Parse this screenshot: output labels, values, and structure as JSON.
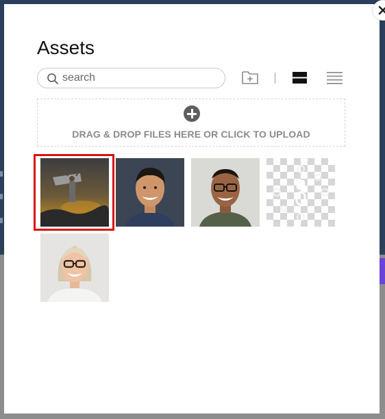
{
  "modal": {
    "title": "Assets",
    "close_icon": "close-icon"
  },
  "search": {
    "placeholder": "search",
    "value": "",
    "icon": "search-icon"
  },
  "toolbar": {
    "new_folder_icon": "folder-plus-icon",
    "view_large_icon": "large-rows-view-icon",
    "view_list_icon": "list-view-icon"
  },
  "upload": {
    "icon": "plus-circle-icon",
    "label": "DRAG & DROP FILES HERE OR CLICK TO UPLOAD"
  },
  "assets": [
    {
      "kind": "photo",
      "subject": "person-with-jetpack-wings",
      "selected": true
    },
    {
      "kind": "photo",
      "subject": "smiling-man",
      "selected": false
    },
    {
      "kind": "photo",
      "subject": "smiling-man-glasses",
      "selected": false
    },
    {
      "kind": "transparent-graphic",
      "subject": "transparent-logo",
      "selected": false
    },
    {
      "kind": "photo",
      "subject": "smiling-woman-glasses",
      "selected": false
    }
  ],
  "colors": {
    "selection": "#d90f0f",
    "backdrop_top": "#2b3f5a",
    "backdrop_bottom": "#8d8d8d",
    "accent_purple": "#6a44d8"
  }
}
